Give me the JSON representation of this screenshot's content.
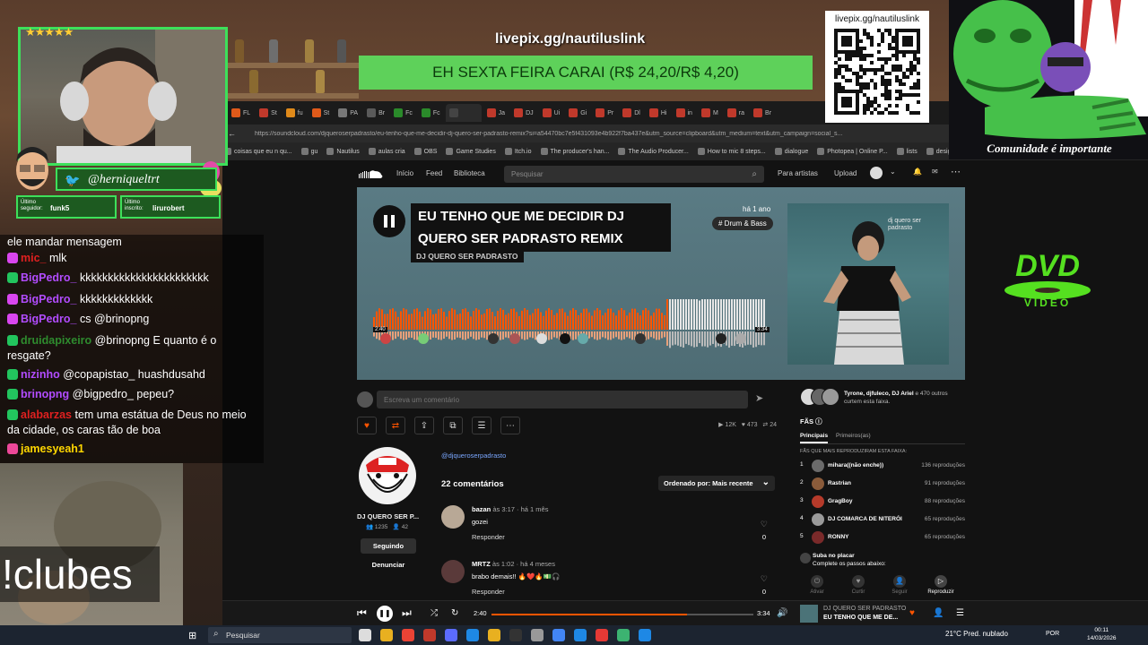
{
  "overlay": {
    "livepix_url": "livepix.gg/nautiluslink",
    "promo_text": "EH SEXTA FEIRA CARAI (R$ 24,20/R$ 4,20)",
    "qr_label": "livepix.gg/nautiluslink",
    "mascot_caption": "Comunidade é importante",
    "dvd_logo": "DVD",
    "dvd_sub": "VIDEO",
    "clubes_command": "!clubes"
  },
  "webcam": {
    "stars": "★★★★★",
    "twitter_handle": "@herniqueltrt",
    "last_follower_label": "Último seguidor:",
    "last_follower": "funk5",
    "last_sub_label": "Último inscrito:",
    "last_sub": "lirurobert"
  },
  "chat": [
    {
      "user": "",
      "text": "ele mandar mensagem",
      "color": "#ffffff"
    },
    {
      "user": "mic_",
      "text": "mlk",
      "color": "#e02020"
    },
    {
      "user": "BigPedro_",
      "text": "kkkkkkkkkkkkkkkkkkkkkkk",
      "color": "#b24cff"
    },
    {
      "user": "BigPedro_",
      "text": "kkkkkkkkkkkkk",
      "color": "#b24cff"
    },
    {
      "user": "BigPedro_",
      "text": "cs @brinopng",
      "color": "#b24cff"
    },
    {
      "user": "druidapixeiro",
      "text": "@brinopng E quanto é o resgate?",
      "color": "#2e8b2e"
    },
    {
      "user": "nizinho",
      "text": "@copapistao_ huashdusahd",
      "color": "#b24cff"
    },
    {
      "user": "brinopng",
      "text": "@bigpedro_ pepeu?",
      "color": "#b24cff"
    },
    {
      "user": "alabarzas",
      "text": "tem uma estátua de Deus no meio da cidade, os caras tão de boa",
      "color": "#e02020"
    },
    {
      "user": "jamesyeah1",
      "text": "",
      "color": "#ffd700"
    }
  ],
  "browser": {
    "url": "https://soundcloud.com/djqueroserpadrasto/eu-tenho-que-me-decidir-dj-quero-ser-padrasto-remix?si=a54470bc7e5f431093e4b922f7ba437e&utm_source=clipboard&utm_medium=text&utm_campaign=social_s...",
    "tabs": [
      "FL",
      "St",
      "fu",
      "St",
      "PA",
      "Br",
      "Fc",
      "Fc",
      "",
      "Ja",
      "DJ",
      "Ui",
      "Gi",
      "Pr",
      "Dl",
      "Hi",
      "in",
      "M",
      "ra",
      "Br"
    ],
    "bookmarks": [
      "coisas que eu n qu...",
      "gu",
      "Nautilus",
      "aulas cria",
      "OBS",
      "Game Studies",
      "Itch.io",
      "The producer's han...",
      "The Audio Producer...",
      "How to mic 8 steps...",
      "dialogue",
      "Photopea | Online P...",
      "lists",
      "design"
    ]
  },
  "soundcloud": {
    "nav": {
      "home": "Início",
      "feed": "Feed",
      "library": "Biblioteca",
      "search_placeholder": "Pesquisar",
      "for_artists": "Para artistas",
      "upload": "Upload"
    },
    "track": {
      "title": "EU TENHO QUE ME DECIDIR DJ QUERO SER PADRASTO REMIX",
      "artist": "DJ QUERO SER PADRASTO",
      "posted": "há 1 ano",
      "tag": "# Drum & Bass",
      "cover_text": "dj quero ser padrasto",
      "current": "2:40",
      "duration": "3:34",
      "progress": 0.747
    },
    "comment_placeholder": "Escreva um comentário",
    "stats": {
      "plays": "12K",
      "likes": "473",
      "reposts": "24"
    },
    "artist": {
      "name": "DJ QUERO SER P...",
      "followers": "1235",
      "following": "42",
      "follow_label": "Seguindo",
      "report_label": "Denunciar",
      "handle": "@djqueroserpadrasto"
    },
    "comments_count": "22 comentários",
    "sort_label": "Ordenado por: Mais recente",
    "comments": [
      {
        "user": "bazan",
        "at": " às 3:17 · há 1 mês",
        "text": "gozei",
        "reply": "Responder",
        "likes": "0"
      },
      {
        "user": "MRTZ",
        "at": " às 1:02 · há 4 meses",
        "text": "brabo demais!! 🔥❤️🔥💵🎧",
        "reply": "Responder",
        "likes": "0"
      }
    ],
    "likers_names": "Tyrone, djfuleco, DJ Ariel",
    "likers_rest": " e 470 outros curtem esta faixa.",
    "fans_title": "FÃS ⓘ",
    "fans_tab_main": "Principais",
    "fans_tab_first": "Primeiros(as)",
    "fans_subtitle": "FÃS QUE MAIS REPRODUZIRAM ESTA FAIXA:",
    "fans": [
      {
        "rank": "1",
        "name": "mihara((não enche))",
        "plays": "136 reproduções",
        "color": "#6b6b6b"
      },
      {
        "rank": "2",
        "name": "Rastrian",
        "plays": "91 reproduções",
        "color": "#8a5b3a"
      },
      {
        "rank": "3",
        "name": "GragBoy",
        "plays": "88 reproduções",
        "color": "#b53a2a"
      },
      {
        "rank": "4",
        "name": "DJ COMARCA DE NITERÓI",
        "plays": "65 reproduções",
        "color": "#9a9a9a"
      },
      {
        "rank": "5",
        "name": "RONNY",
        "plays": "65 reproduções",
        "color": "#7a2a2a"
      }
    ],
    "podium_title": "Suba no placar",
    "podium_sub": "Complete os passos abaixo:",
    "podium_steps": [
      "Ativar",
      "Curtir",
      "Seguir",
      "Reproduzir"
    ],
    "player": {
      "artist": "DJ QUERO SER PADRASTO",
      "title": "EU TENHO QUE ME DE..."
    }
  },
  "taskbar": {
    "search_placeholder": "Pesquisar",
    "weather": "21°C  Pred. nublado",
    "lang": "POR",
    "time": "00:11",
    "date": "14/03/2026"
  },
  "colors": {
    "accent": "#ff5500",
    "promo_green": "#5ed15a",
    "overlay_green": "#3de05a"
  }
}
